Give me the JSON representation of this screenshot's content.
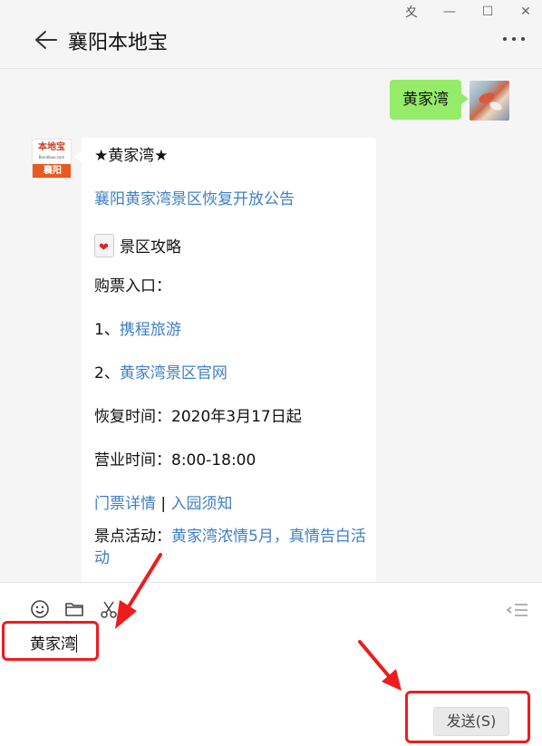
{
  "window": {
    "controls": [
      "pin",
      "minimize",
      "maximize",
      "close"
    ],
    "pin_glyph": "⼢",
    "minimize_glyph": "—",
    "maximize_glyph": "☐",
    "close_glyph": "✕"
  },
  "header": {
    "title": "襄阳本地宝",
    "back_icon": "back-arrow-icon",
    "more_icon": "more-icon"
  },
  "chat": {
    "outgoing": {
      "text": "黄家湾"
    },
    "incoming": {
      "avatar": {
        "logo_text": "本地宝",
        "logo_sub": "Bendibao.com",
        "logo_bar": "襄阳"
      },
      "title": "★黄家湾★",
      "notice_link": "襄阳黄家湾景区恢复开放公告",
      "guide_label": "景区攻略",
      "ticket_label": "购票入口：",
      "option1_prefix": "1、",
      "option1_link": "携程旅游",
      "option2_prefix": "2、",
      "option2_link": "黄家湾景区官网",
      "resume_time": "恢复时间：2020年3月17日起",
      "business_hours": "营业时间：8:00-18:00",
      "ticket_details_link": "门票详情",
      "separator": "|",
      "entry_notice_link": "入园须知",
      "activity_label": "景点活动：",
      "activity_link": "黄家湾浓情5月，真情告白活动"
    }
  },
  "input": {
    "text": "黄家湾",
    "send_label": "发送(S)",
    "tools": [
      "emoji-icon",
      "folder-icon",
      "scissors-icon"
    ]
  },
  "colors": {
    "bubble_green": "#95ec69",
    "link_blue": "#3f7fc3",
    "highlight_red": "#ee1c1c"
  }
}
